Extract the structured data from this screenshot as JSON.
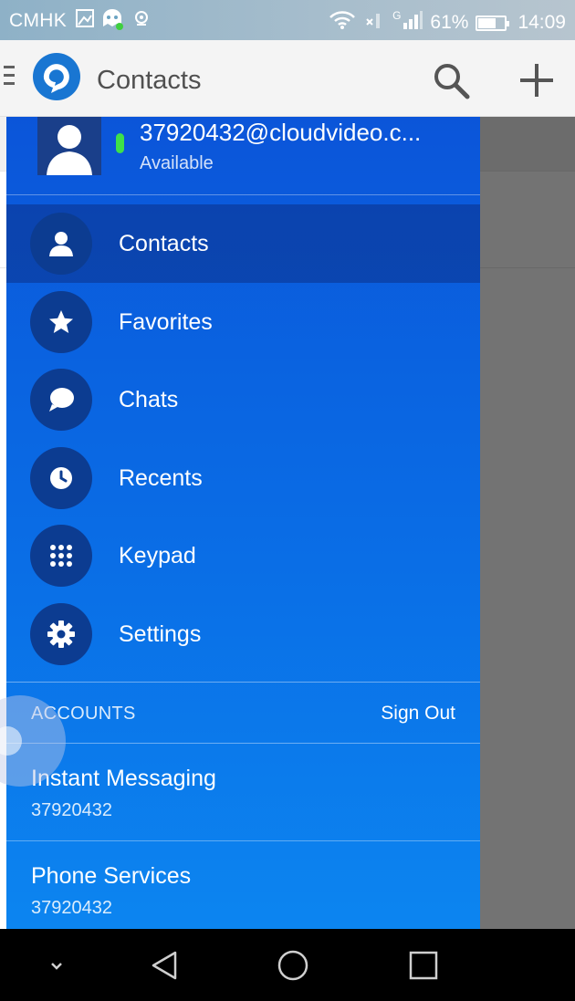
{
  "status_bar": {
    "carrier": "CMHK",
    "network": "G",
    "battery": "61%",
    "time": "14:09",
    "icons": [
      "image-icon",
      "ghost-app-icon",
      "location-icon",
      "wifi-icon",
      "no-sim-icon",
      "signal-icon",
      "battery-icon"
    ]
  },
  "app_bar": {
    "title": "Contacts",
    "icons": [
      "menu-icon",
      "app-logo-icon",
      "search-icon",
      "add-icon"
    ]
  },
  "drawer": {
    "user": {
      "id": "37920432@cloudvideo.c...",
      "status": "Available"
    },
    "nav_items": [
      {
        "label": "Contacts",
        "icon": "person-icon",
        "active": true
      },
      {
        "label": "Favorites",
        "icon": "star-icon",
        "active": false
      },
      {
        "label": "Chats",
        "icon": "chat-bubble-icon",
        "active": false
      },
      {
        "label": "Recents",
        "icon": "clock-icon",
        "active": false
      },
      {
        "label": "Keypad",
        "icon": "keypad-icon",
        "active": false
      },
      {
        "label": "Settings",
        "icon": "gear-icon",
        "active": false
      }
    ],
    "accounts": {
      "header": "ACCOUNTS",
      "sign_out": "Sign Out",
      "items": [
        {
          "name": "Instant Messaging",
          "number": "37920432"
        },
        {
          "name": "Phone Services",
          "number": "37920432"
        }
      ]
    }
  },
  "nav_bar": {
    "icons": [
      "chevron-down-icon",
      "back-icon",
      "home-icon",
      "recents-icon"
    ]
  },
  "colors": {
    "drawer_top": "#0b55d9",
    "drawer_bottom": "#0c85f0",
    "nav_circle": "#0c3c91",
    "presence": "#3ee04a",
    "app_bar": "#f4f4f4"
  }
}
